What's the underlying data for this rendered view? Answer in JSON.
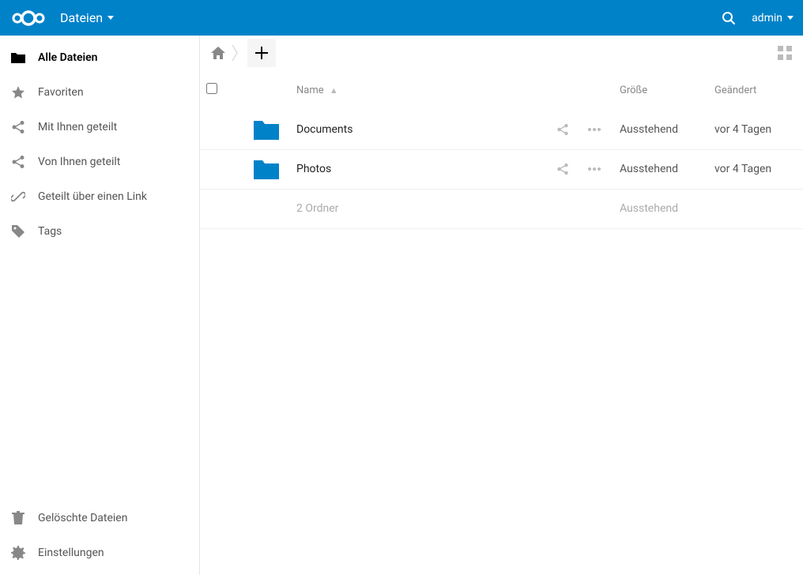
{
  "header": {
    "app_label": "Dateien",
    "user_label": "admin"
  },
  "sidebar": {
    "items": [
      {
        "label": "Alle Dateien",
        "icon": "folder-solid-icon",
        "active": true
      },
      {
        "label": "Favoriten",
        "icon": "star-icon",
        "active": false
      },
      {
        "label": "Mit Ihnen geteilt",
        "icon": "share-icon",
        "active": false
      },
      {
        "label": "Von Ihnen geteilt",
        "icon": "share-icon",
        "active": false
      },
      {
        "label": "Geteilt über einen Link",
        "icon": "link-icon",
        "active": false
      },
      {
        "label": "Tags",
        "icon": "tag-icon",
        "active": false
      }
    ],
    "bottom": [
      {
        "label": "Gelöschte Dateien",
        "icon": "trash-icon"
      },
      {
        "label": "Einstellungen",
        "icon": "gear-icon"
      }
    ]
  },
  "table": {
    "headers": {
      "name": "Name",
      "size": "Größe",
      "modified": "Geändert"
    },
    "rows": [
      {
        "name": "Documents",
        "size": "Ausstehend",
        "modified": "vor 4 Tagen"
      },
      {
        "name": "Photos",
        "size": "Ausstehend",
        "modified": "vor 4 Tagen"
      }
    ],
    "summary": {
      "count": "2 Ordner",
      "size": "Ausstehend"
    }
  }
}
